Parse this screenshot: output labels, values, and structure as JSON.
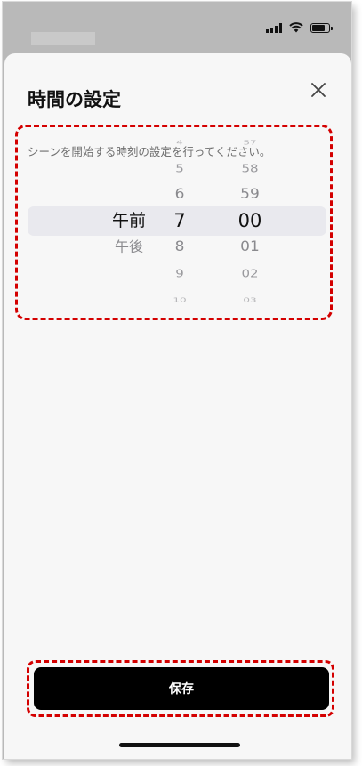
{
  "sheet": {
    "title": "時間の設定",
    "description": "シーンを開始する時刻の設定を行ってください。",
    "close_icon": "close-icon"
  },
  "picker": {
    "ampm": {
      "selected": "午前",
      "items": [
        {
          "label": "午前",
          "offset": 0
        },
        {
          "label": "午後",
          "offset": 1
        }
      ]
    },
    "hours": {
      "selected": "7",
      "items": [
        {
          "label": "4",
          "offset": -3
        },
        {
          "label": "5",
          "offset": -2
        },
        {
          "label": "6",
          "offset": -1
        },
        {
          "label": "7",
          "offset": 0
        },
        {
          "label": "8",
          "offset": 1
        },
        {
          "label": "9",
          "offset": 2
        },
        {
          "label": "10",
          "offset": 3
        }
      ]
    },
    "minutes": {
      "selected": "00",
      "items": [
        {
          "label": "57",
          "offset": -3
        },
        {
          "label": "58",
          "offset": -2
        },
        {
          "label": "59",
          "offset": -1
        },
        {
          "label": "00",
          "offset": 0
        },
        {
          "label": "01",
          "offset": 1
        },
        {
          "label": "02",
          "offset": 2
        },
        {
          "label": "03",
          "offset": 3
        }
      ]
    }
  },
  "footer": {
    "save_label": "保存"
  },
  "colors": {
    "accent_outline": "#d40000",
    "button_bg": "#000000",
    "button_text": "#ffffff"
  }
}
